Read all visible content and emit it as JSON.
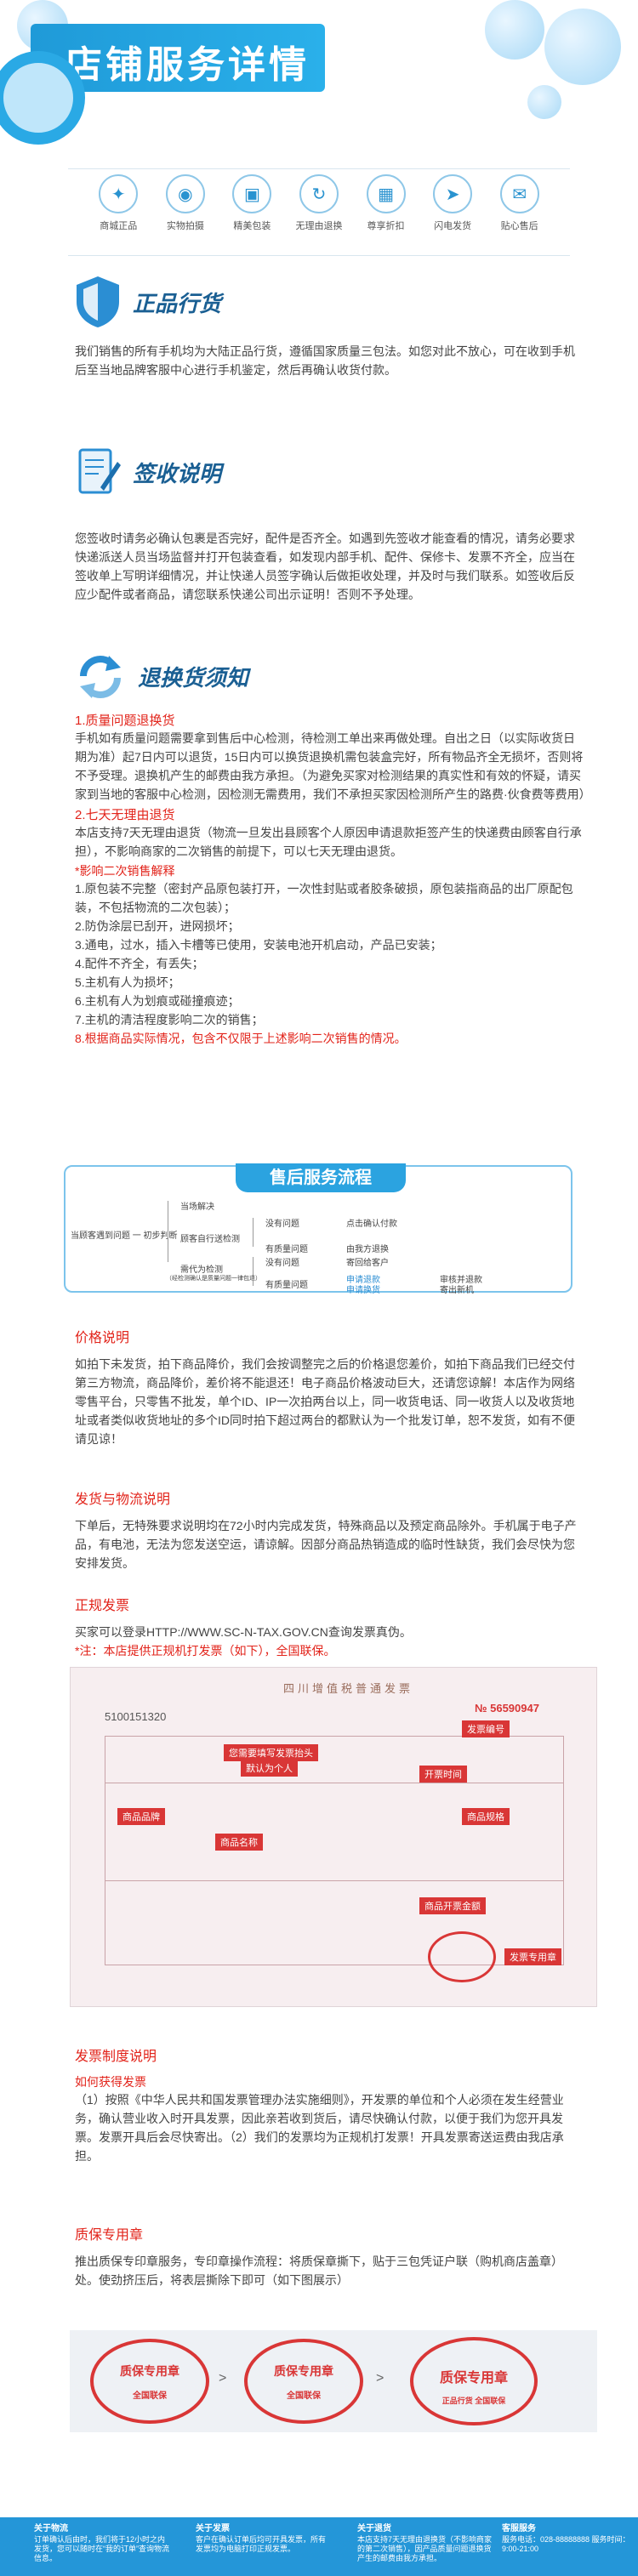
{
  "header": {
    "title": "店铺服务详情"
  },
  "icons": [
    {
      "label": "商城正品",
      "name": "genuine-icon",
      "glyph": "✦"
    },
    {
      "label": "实物拍摄",
      "name": "camera-icon",
      "glyph": "◉"
    },
    {
      "label": "精美包装",
      "name": "package-icon",
      "glyph": "▣"
    },
    {
      "label": "无理由退换",
      "name": "refresh-icon",
      "glyph": "↻"
    },
    {
      "label": "尊享折扣",
      "name": "calculator-icon",
      "glyph": "▦"
    },
    {
      "label": "闪电发货",
      "name": "truck-icon",
      "glyph": "➤"
    },
    {
      "label": "贴心售后",
      "name": "chat-icon",
      "glyph": "✉"
    }
  ],
  "genuine": {
    "title": "正品行货",
    "text": "我们销售的所有手机均为大陆正品行货，遵循国家质量三包法。如您对此不放心，可在收到手机后至当地品牌客服中心进行手机鉴定，然后再确认收货付款。"
  },
  "receipt": {
    "title": "签收说明",
    "text": "您签收时请务必确认包裹是否完好，配件是否齐全。如遇到先签收才能查看的情况，请务必要求快递派送人员当场监督并打开包装查看，如发现内部手机、配件、保修卡、发票不齐全，应当在签收单上写明详细情况，并让快递人员签字确认后做拒收处理，并及时与我们联系。如签收后反应少配件或者商品，请您联系快递公司出示证明！否则不予处理。"
  },
  "returns": {
    "title": "退换货须知",
    "h1": "1.质量问题退换货",
    "p1": "手机如有质量问题需要拿到售后中心检测，待检测工单出来再做处理。自出之日（以实际收货日期为准）起7日内可以退货，15日内可以换货退换机需包装盒完好，所有物品齐全无损坏，否则将不予受理。退换机产生的邮费由我方承担。（为避免买家对检测结果的真实性和有效的怀疑，请买家到当地的客服中心检测，因检测无需费用，我们不承担买家因检测所产生的路费·伙食费等费用）",
    "h2": "2.七天无理由退货",
    "p2": "本店支持7天无理由退货（物流一旦发出县顾客个人原因申请退款拒签产生的快递费由顾客自行承担），不影响商家的二次销售的前提下，可以七天无理由退货。",
    "h3": "*影响二次销售解释",
    "items": [
      "1.原包装不完整（密封产品原包装打开，一次性封贴或者胶条破损，原包装指商品的出厂原配包装，不包括物流的二次包装）；",
      "2.防伪涂层已刮开，进网损坏；",
      "3.通电，过水，插入卡槽等已使用，安装电池开机启动，产品已安装；",
      "4.配件不齐全，有丢失；",
      "5.主机有人为损坏；",
      "6.主机有人为划痕或碰撞痕迹；",
      "7.主机的清洁程度影响二次的销售；"
    ],
    "last": "8.根据商品实际情况，包含不仅限于上述影响二次销售的情况。"
  },
  "flow": {
    "title": "售后服务流程",
    "nodes": {
      "start": "当顾客遇到问题 一 初步判断",
      "a1": "当场解决",
      "a2": "顾客自行送检测",
      "a3": "需代为检测",
      "a3s": "（经检测确认是质量问题一律包退）",
      "b1": "没有问题",
      "b2": "有质量问题",
      "b3": "没有问题",
      "b4": "有质量问题",
      "c1": "点击确认付款",
      "c2": "由我方退换",
      "c3": "寄回给客户",
      "c4": "申请退款",
      "c5": "申请换货",
      "d1": "审核并退款",
      "d2": "寄出新机"
    }
  },
  "price": {
    "title": "价格说明",
    "text": "如拍下未发货，拍下商品降价，我们会按调整完之后的价格退您差价，如拍下商品我们已经交付第三方物流，商品降价，差价将不能退还！电子商品价格波动巨大，还请您谅解！本店作为网络零售平台，只零售不批发，单个ID、IP一次拍两台以上，同一收货电话、同一收货人以及收货地址或者类似收货地址的多个ID同时拍下超过两台的都默认为一个批发订单，恕不发货，如有不便请见谅！"
  },
  "shipping": {
    "title": "发货与物流说明",
    "text": "下单后，无特殊要求说明均在72小时内完成发货，特殊商品以及预定商品除外。手机属于电子产品，有电池，无法为您发送空运，请谅解。因部分商品热销造成的临时性缺货，我们会尽快为您安排发货。"
  },
  "invoice": {
    "title": "正规发票",
    "text": "买家可以登录HTTP://WWW.SC-N-TAX.GOV.CN查询发票真伪。",
    "note": "*注：本店提供正规机打发票（如下），全国联保。",
    "number": "5100151320",
    "serial": "№ 56590947",
    "header": "四川增值税普通发票",
    "labels": {
      "company": "您需要填写发票抬头",
      "company2": "默认为个人",
      "invoice_no": "发票编号",
      "product": "商品品牌",
      "name": "商品名称",
      "spec": "商品规格",
      "time": "开票时间",
      "money": "商品开票金额",
      "seal": "发票专用章"
    }
  },
  "policy": {
    "title": "发票制度说明",
    "sub": "如何获得发票",
    "text": "（1）按照《中华人民共和国发票管理办法实施细则》，开发票的单位和个人必须在发生经营业务，确认营业收入时开具发票，因此亲若收到货后，请尽快确认付款，以便于我们为您开具发票。发票开具后会尽快寄出。（2）我们的发票均为正规机打发票！开具发票寄送运费由我店承担。"
  },
  "warranty": {
    "title": "质保专用章",
    "text": "推出质保专印章服务，专印章操作流程：将质保章撕下，贴于三包凭证户联（购机商店盖章）处。使劲挤压后，将表层撕除下即可（如下图展示）",
    "seal_text": "质保专用章",
    "seal_bottom": "全国联保",
    "seal_bottom2": "正品行货  全国联保"
  },
  "footer": {
    "cols": [
      {
        "title": "关于物流",
        "text": "订单确认后由时，我们将于12小时之内发货，您可以随时在“我的订单”查询物流信息。"
      },
      {
        "title": "关于发票",
        "text": "客户在确认订单后均可开具发票，所有发票均为电脑打印正规发票。"
      },
      {
        "title": "关于退货",
        "text": "本店支持7天无理由退换货（不影响商家的第二次销售），因产品质量问题退换货产生的邮费由我方承担。"
      },
      {
        "title": "客服服务",
        "text": "服务电话：028-88888888  服务时间：9:00-21:00"
      }
    ]
  }
}
